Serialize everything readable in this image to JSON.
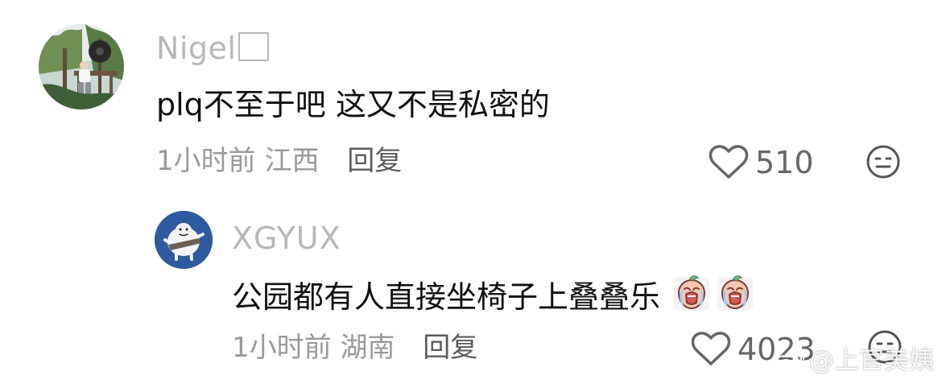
{
  "comments": [
    {
      "username": "Nigel",
      "text": "plq不至于吧 这又不是私密的",
      "time": "1小时前",
      "location": "江西",
      "reply_label": "回复",
      "likes": "510",
      "reaction_icon": "neutral-face-icon",
      "avatar_icon": "profile-photo-avatar"
    },
    {
      "username": "XGYUX",
      "text": "公园都有人直接坐椅子上叠叠乐",
      "time": "1小时前",
      "location": "湖南",
      "reply_label": "回复",
      "likes": "4023",
      "reaction_icon": "neutral-face-icon",
      "avatar_icon": "cartoon-avatar",
      "emoji_icons": [
        "crying-peach-emoji",
        "crying-peach-emoji"
      ]
    }
  ],
  "watermark": {
    "text": "@上官美姨",
    "icon": "weibo-logo-icon"
  },
  "colors": {
    "background": "#ffffff",
    "primary_text": "#111111",
    "secondary_text": "#9a9a9a",
    "username_text": "#b7b7b7",
    "avatar_blue": "#2e5a9f"
  }
}
